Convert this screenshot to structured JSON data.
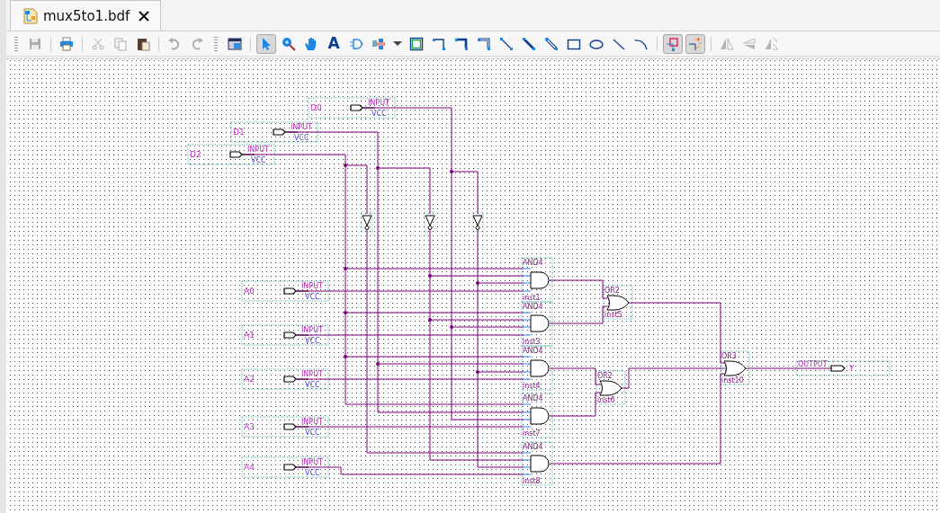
{
  "tab": {
    "label": "mux5to1.bdf",
    "selected": true
  },
  "toolbar": [
    {
      "disabled": true,
      "on": false
    },
    {
      "disabled": false,
      "on": false
    },
    {
      "disabled": true,
      "on": false
    },
    {
      "disabled": true,
      "on": false
    },
    {
      "disabled": false,
      "on": false
    },
    {
      "disabled": true,
      "on": false
    },
    {
      "disabled": true,
      "on": false
    },
    {
      "disabled": false,
      "on": false
    },
    {
      "disabled": false,
      "on": true
    },
    {
      "disabled": false,
      "on": false
    },
    {
      "disabled": false,
      "on": false
    },
    {
      "disabled": false,
      "on": false,
      "text": "A"
    },
    {
      "disabled": false,
      "on": false
    },
    {
      "disabled": false,
      "on": false
    },
    {
      "disabled": false,
      "on": false
    },
    {
      "disabled": false,
      "on": false
    },
    {
      "disabled": false,
      "on": false
    },
    {
      "disabled": false,
      "on": false
    },
    {
      "disabled": false,
      "on": false
    },
    {
      "disabled": false,
      "on": false
    },
    {
      "disabled": false,
      "on": false
    },
    {
      "disabled": false,
      "on": false
    },
    {
      "disabled": false,
      "on": false
    },
    {
      "disabled": false,
      "on": false
    },
    {
      "disabled": false,
      "on": false
    },
    {
      "disabled": false,
      "on": false
    },
    {
      "disabled": false,
      "on": true
    },
    {
      "disabled": false,
      "on": true
    },
    {
      "disabled": true,
      "on": false
    },
    {
      "disabled": true,
      "on": false
    },
    {
      "disabled": true,
      "on": false
    }
  ],
  "schematic": {
    "input_pins": [
      {
        "name": "D0",
        "type": "INPUT",
        "default": "VCC"
      },
      {
        "name": "D1",
        "type": "INPUT",
        "default": "VCC"
      },
      {
        "name": "D2",
        "type": "INPUT",
        "default": "VCC"
      },
      {
        "name": "A0",
        "type": "INPUT",
        "default": "VCC"
      },
      {
        "name": "A1",
        "type": "INPUT",
        "default": "VCC"
      },
      {
        "name": "A2",
        "type": "INPUT",
        "default": "VCC"
      },
      {
        "name": "A3",
        "type": "INPUT",
        "default": "VCC"
      },
      {
        "name": "A4",
        "type": "INPUT",
        "default": "VCC"
      }
    ],
    "and_gates": [
      {
        "type": "AND4",
        "instance": "inst1"
      },
      {
        "type": "AND4",
        "instance": "inst3"
      },
      {
        "type": "AND4",
        "instance": "inst4"
      },
      {
        "type": "AND4",
        "instance": "inst7"
      },
      {
        "type": "AND4",
        "instance": "inst8"
      }
    ],
    "or_gates": [
      {
        "type": "OR2",
        "instance": "inst5"
      },
      {
        "type": "OR2",
        "instance": "inst6"
      },
      {
        "type": "OR3",
        "instance": "inst10"
      }
    ],
    "output_pin": {
      "type": "OUTPUT",
      "name": "Y"
    }
  }
}
